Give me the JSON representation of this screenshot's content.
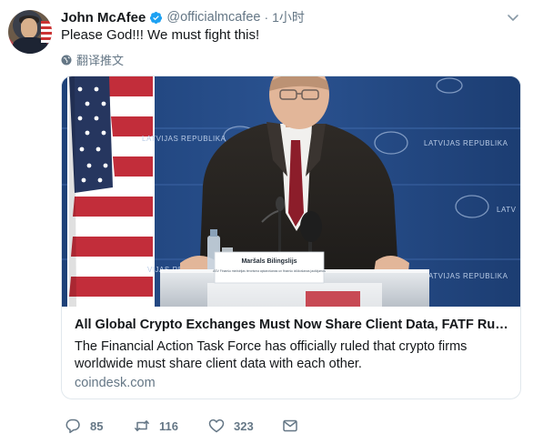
{
  "user": {
    "display_name": "John McAfee",
    "handle": "@officialmcafee",
    "separator": "·",
    "time": "1小时"
  },
  "tweet": {
    "text": "Please God!!! We must fight this!",
    "translate_label": "翻译推文"
  },
  "card": {
    "title": "All Global Crypto Exchanges Must Now Share Client Data, FATF Rule...",
    "description": "The Financial Action Task Force has officially ruled that crypto firms worldwide must share client data with each other.",
    "domain": "coindesk.com",
    "image_text": {
      "backdrop_left": "LATVIJAS REPUBLIKA",
      "backdrop_right": "LATVIJAS REPUBLIKA",
      "backdrop_right_lower": "LATVIJAS REPUBLIKA",
      "backdrop_mid_right": "LATV",
      "backdrop_low_left": "VIJAS REPU",
      "nameplate_name": "Maršals Bilingslijs",
      "nameplate_subtitle": "ASV Finanšu ministrijas terorisma apkarošanas un finanšu izlūkošanas jautājumos"
    }
  },
  "actions": {
    "reply_count": "85",
    "retweet_count": "116",
    "like_count": "323"
  },
  "colors": {
    "verified": "#1da1f2",
    "secondary_text": "#657786",
    "border": "#e1e8ed",
    "primary_text": "#14171a"
  },
  "icons": {
    "verified": "verified-badge-icon",
    "caret": "chevron-down-icon",
    "translate": "globe-icon",
    "reply": "reply-icon",
    "retweet": "retweet-icon",
    "like": "heart-icon",
    "dm": "envelope-icon"
  }
}
